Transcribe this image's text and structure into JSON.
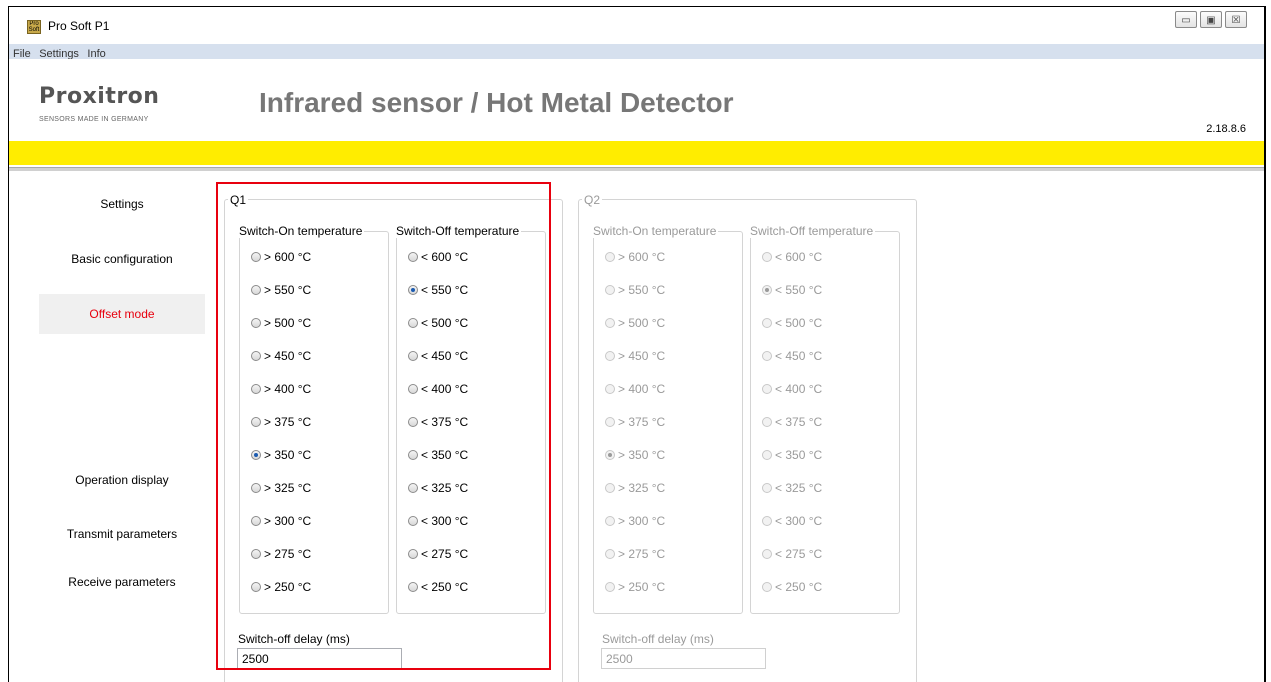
{
  "window": {
    "icon_text": "Pro Soft",
    "title": "Pro Soft P1",
    "controls": {
      "minimize": "▭",
      "restore": "▣",
      "close": "☒"
    }
  },
  "menu": [
    "File",
    "Settings",
    "Info"
  ],
  "header": {
    "logo": "Proxitron",
    "logo_sub": "SENSORS MADE IN GERMANY",
    "heading": "Infrared sensor  / Hot Metal Detector",
    "version": "2.18.8.6"
  },
  "colors": {
    "accent_bar": "#ffed00",
    "active_nav": "#e8000e",
    "highlight": "#e8000e"
  },
  "nav": [
    {
      "label": "Settings",
      "active": false
    },
    {
      "label": "Basic configuration",
      "active": false
    },
    {
      "label": "Offset mode",
      "active": true
    },
    {
      "label": "Operation display",
      "active": false
    },
    {
      "label": "Transmit parameters",
      "active": false
    },
    {
      "label": "Receive parameters",
      "active": false
    }
  ],
  "q1": {
    "title": "Q1",
    "switch_on_title": "Switch-On temperature",
    "switch_off_title": "Switch-Off temperature",
    "switch_on": [
      "> 600 °C",
      "> 550 °C",
      "> 500 °C",
      "> 450 °C",
      "> 400 °C",
      "> 375 °C",
      "> 350 °C",
      "> 325 °C",
      "> 300 °C",
      "> 275 °C",
      "> 250 °C"
    ],
    "switch_off": [
      "< 600 °C",
      "< 550 °C",
      "< 500 °C",
      "< 450 °C",
      "< 400 °C",
      "< 375 °C",
      "< 350 °C",
      "< 325 °C",
      "< 300 °C",
      "< 275 °C",
      "< 250 °C"
    ],
    "switch_on_selected": "> 350 °C",
    "switch_off_selected": "< 550 °C",
    "delay_label": "Switch-off delay (ms)",
    "delay_value": "2500",
    "enabled": true
  },
  "q2": {
    "title": "Q2",
    "switch_on_title": "Switch-On temperature",
    "switch_off_title": "Switch-Off temperature",
    "switch_on": [
      "> 600 °C",
      "> 550 °C",
      "> 500 °C",
      "> 450 °C",
      "> 400 °C",
      "> 375 °C",
      "> 350 °C",
      "> 325 °C",
      "> 300 °C",
      "> 275 °C",
      "> 250 °C"
    ],
    "switch_off": [
      "< 600 °C",
      "< 550 °C",
      "< 500 °C",
      "< 450 °C",
      "< 400 °C",
      "< 375 °C",
      "< 350 °C",
      "< 325 °C",
      "< 300 °C",
      "< 275 °C",
      "< 250 °C"
    ],
    "switch_on_selected": "> 350 °C",
    "switch_off_selected": "< 550 °C",
    "delay_label": "Switch-off delay (ms)",
    "delay_value": "2500",
    "enabled": false
  }
}
